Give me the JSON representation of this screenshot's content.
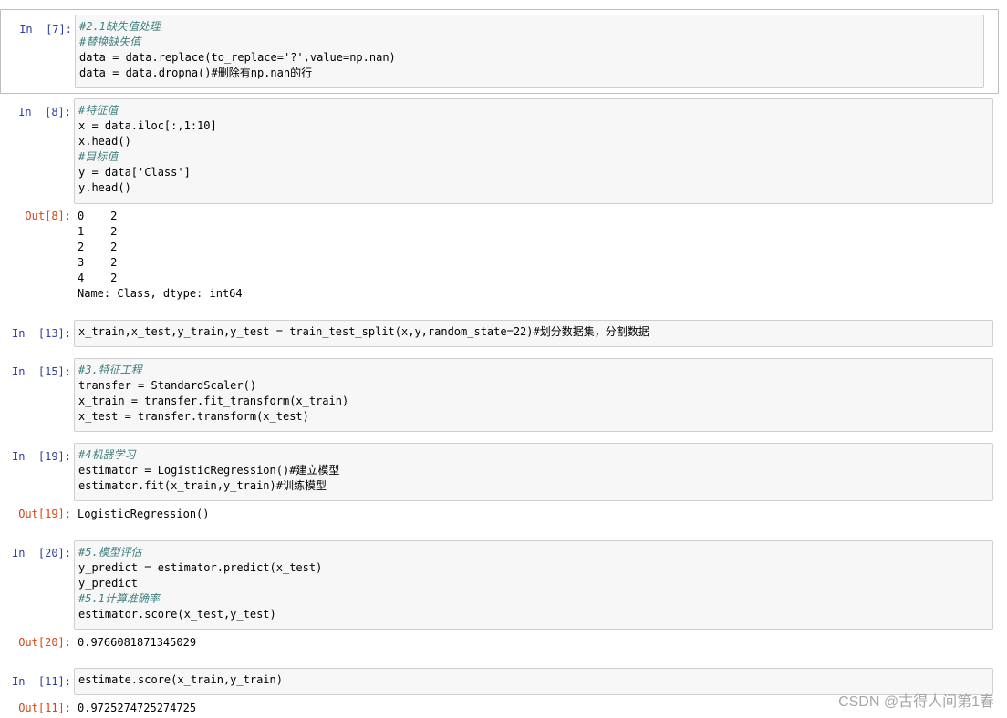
{
  "cells": {
    "c7": {
      "in_prompt": "In  [7]:",
      "lines": [
        "#2.1缺失值处理",
        "#替换缺失值",
        "data = data.replace(to_replace='?',value=np.nan)",
        "data = data.dropna()#删除有np.nan的行"
      ]
    },
    "c8": {
      "in_prompt": "In  [8]:",
      "lines": [
        "#特征值",
        "x = data.iloc[:,1:10]",
        "x.head()",
        "#目标值",
        "y = data['Class']",
        "y.head()"
      ],
      "out_prompt": "Out[8]:",
      "out_lines": [
        "0    2",
        "1    2",
        "2    2",
        "3    2",
        "4    2",
        "Name: Class, dtype: int64"
      ]
    },
    "c13": {
      "in_prompt": "In  [13]:",
      "lines": [
        "x_train,x_test,y_train,y_test = train_test_split(x,y,random_state=22)#划分数据集，分割数据"
      ]
    },
    "c15": {
      "in_prompt": "In  [15]:",
      "lines": [
        "#3.特征工程",
        "transfer = StandardScaler()",
        "x_train = transfer.fit_transform(x_train)",
        "x_test = transfer.transform(x_test)"
      ]
    },
    "c19": {
      "in_prompt": "In  [19]:",
      "lines": [
        "#4机器学习",
        "estimator = LogisticRegression()#建立模型",
        "estimator.fit(x_train,y_train)#训练模型"
      ],
      "out_prompt": "Out[19]:",
      "out_lines": [
        "LogisticRegression()"
      ]
    },
    "c20": {
      "in_prompt": "In  [20]:",
      "lines": [
        "#5.模型评估",
        "y_predict = estimator.predict(x_test)",
        "y_predict",
        "#5.1计算准确率",
        "estimator.score(x_test,y_test)"
      ],
      "out_prompt": "Out[20]:",
      "out_lines": [
        "0.9766081871345029"
      ]
    },
    "c11": {
      "in_prompt": "In  [11]:",
      "lines": [
        "estimate.score(x_train,y_train)"
      ],
      "out_prompt": "Out[11]:",
      "out_lines": [
        "0.9725274725274725"
      ]
    }
  },
  "watermark": "CSDN @古得人间第1春"
}
